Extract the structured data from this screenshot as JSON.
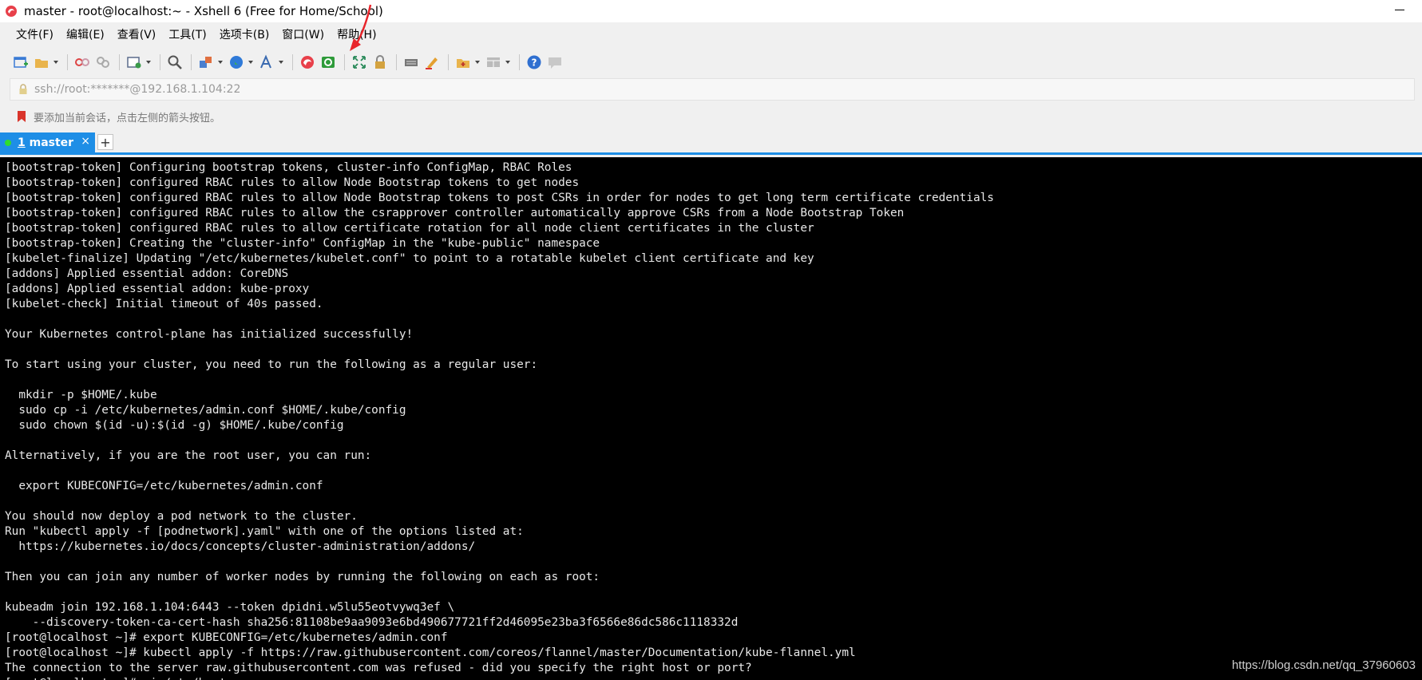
{
  "window": {
    "title": "master - root@localhost:~ - Xshell 6 (Free for Home/School)"
  },
  "menu": [
    {
      "label": "文件(F)"
    },
    {
      "label": "编辑(E)"
    },
    {
      "label": "查看(V)"
    },
    {
      "label": "工具(T)"
    },
    {
      "label": "选项卡(B)"
    },
    {
      "label": "窗口(W)"
    },
    {
      "label": "帮助(H)"
    }
  ],
  "toolbar": {
    "icons": [
      "new-session-icon",
      "open-folder-icon",
      "disconnect-icon",
      "reconnect-icon",
      "session-properties-icon",
      "find-icon",
      "transfer-icon",
      "globe-icon",
      "font-icon",
      "xshell-icon",
      "xftp-icon",
      "fullscreen-icon",
      "lock-icon",
      "keyboard-icon",
      "highlight-icon",
      "new-folder-icon",
      "layout-icon",
      "help-icon",
      "chat-icon"
    ]
  },
  "address": {
    "value": "ssh://root:*******@192.168.1.104:22"
  },
  "hint": {
    "text": "要添加当前会话，点击左侧的箭头按钮。"
  },
  "tabs": [
    {
      "number": "1",
      "label": "master",
      "active": true
    }
  ],
  "tab_close": "×",
  "tab_add": "+",
  "colors": {
    "accent": "#1e8ee6",
    "terminal_bg": "#000000",
    "terminal_fg": "#e8e8e8",
    "annotation": "#e8252b"
  },
  "terminal": {
    "lines": [
      "[bootstrap-token] Configuring bootstrap tokens, cluster-info ConfigMap, RBAC Roles",
      "[bootstrap-token] configured RBAC rules to allow Node Bootstrap tokens to get nodes",
      "[bootstrap-token] configured RBAC rules to allow Node Bootstrap tokens to post CSRs in order for nodes to get long term certificate credentials",
      "[bootstrap-token] configured RBAC rules to allow the csrapprover controller automatically approve CSRs from a Node Bootstrap Token",
      "[bootstrap-token] configured RBAC rules to allow certificate rotation for all node client certificates in the cluster",
      "[bootstrap-token] Creating the \"cluster-info\" ConfigMap in the \"kube-public\" namespace",
      "[kubelet-finalize] Updating \"/etc/kubernetes/kubelet.conf\" to point to a rotatable kubelet client certificate and key",
      "[addons] Applied essential addon: CoreDNS",
      "[addons] Applied essential addon: kube-proxy",
      "[kubelet-check] Initial timeout of 40s passed.",
      "",
      "Your Kubernetes control-plane has initialized successfully!",
      "",
      "To start using your cluster, you need to run the following as a regular user:",
      "",
      "  mkdir -p $HOME/.kube",
      "  sudo cp -i /etc/kubernetes/admin.conf $HOME/.kube/config",
      "  sudo chown $(id -u):$(id -g) $HOME/.kube/config",
      "",
      "Alternatively, if you are the root user, you can run:",
      "",
      "  export KUBECONFIG=/etc/kubernetes/admin.conf",
      "",
      "You should now deploy a pod network to the cluster.",
      "Run \"kubectl apply -f [podnetwork].yaml\" with one of the options listed at:",
      "  https://kubernetes.io/docs/concepts/cluster-administration/addons/",
      "",
      "Then you can join any number of worker nodes by running the following on each as root:",
      "",
      "kubeadm join 192.168.1.104:6443 --token dpidni.w5lu55eotvywq3ef \\",
      "    --discovery-token-ca-cert-hash sha256:81108be9aa9093e6bd490677721ff2d46095e23ba3f6566e86dc586c1118332d",
      "[root@localhost ~]# export KUBECONFIG=/etc/kubernetes/admin.conf",
      "[root@localhost ~]# kubectl apply -f https://raw.githubusercontent.com/coreos/flannel/master/Documentation/kube-flannel.yml",
      "The connection to the server raw.githubusercontent.com was refused - did you specify the right host or port?",
      "[root@localhost ~]# vi /etc/hosts"
    ]
  },
  "watermark": "https://blog.csdn.net/qq_37960603"
}
